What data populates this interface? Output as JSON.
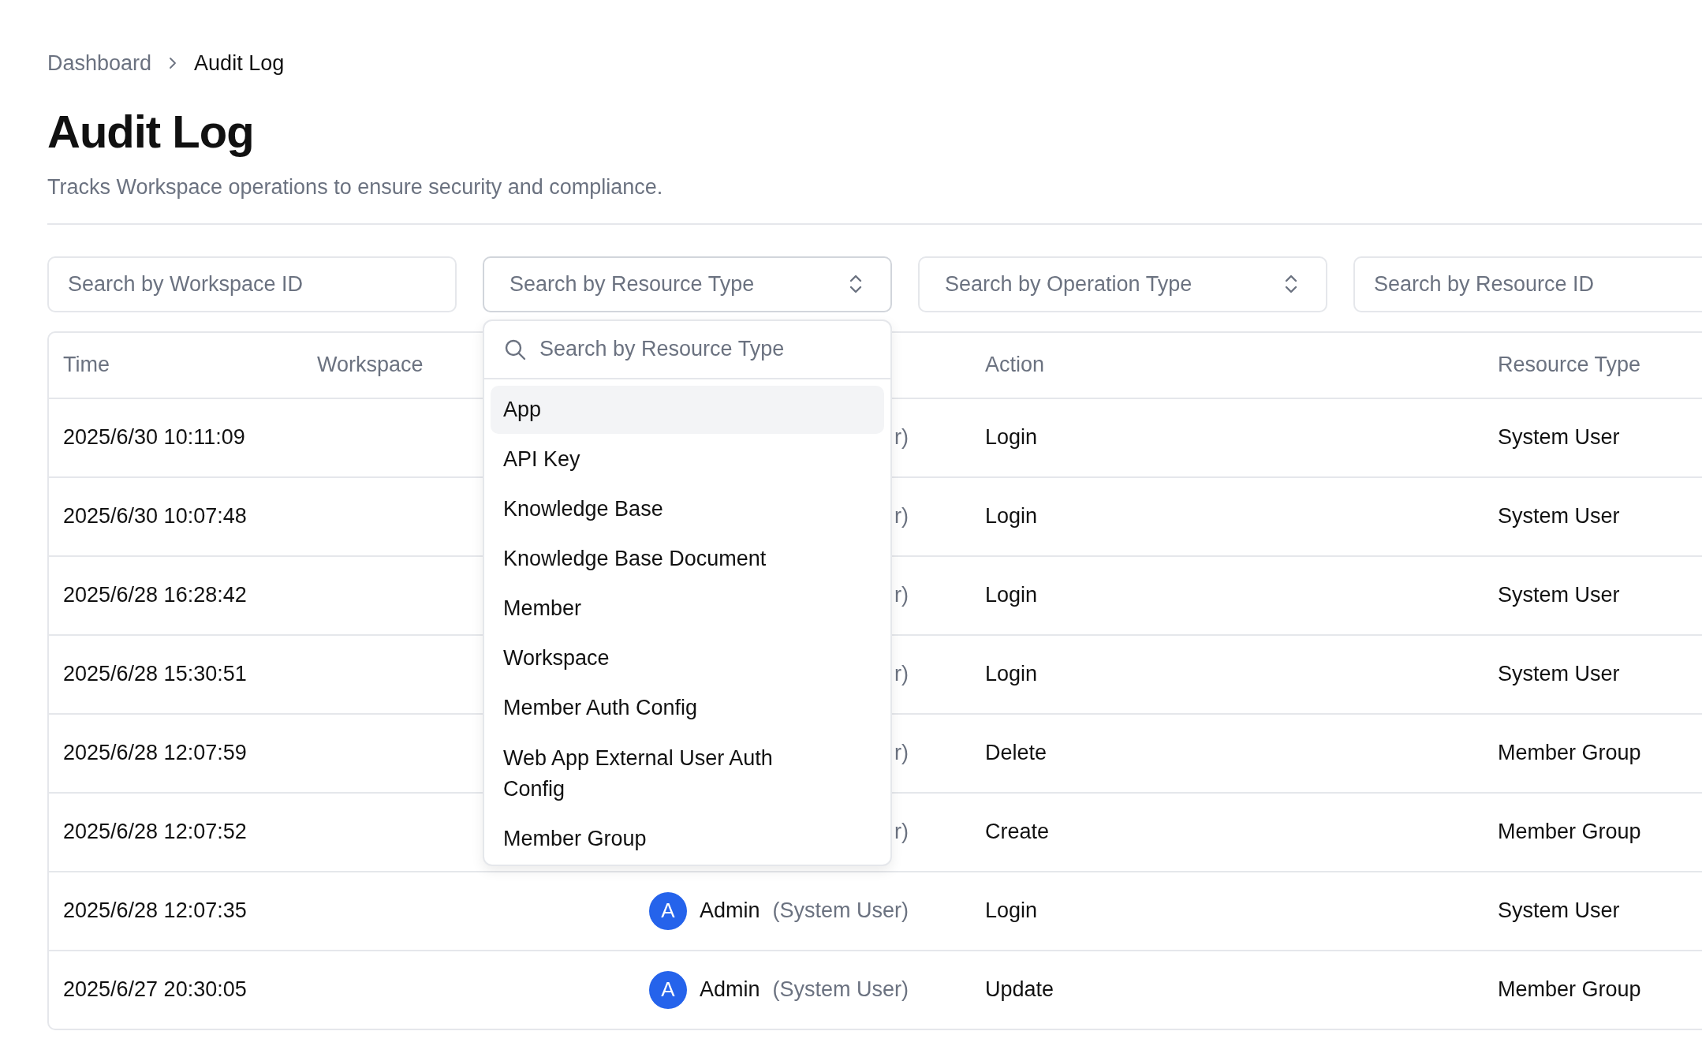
{
  "breadcrumb": [
    {
      "label": "Dashboard",
      "current": false
    },
    {
      "label": "Audit Log",
      "current": true
    }
  ],
  "title": "Audit Log",
  "subtitle": "Tracks Workspace operations to ensure security and compliance.",
  "filters": [
    {
      "kind": "text",
      "placeholder": "Search by Workspace ID"
    },
    {
      "kind": "select",
      "placeholder": "Search by Resource Type",
      "expanded": true
    },
    {
      "kind": "select",
      "placeholder": "Search by Operation Type",
      "expanded": false
    },
    {
      "kind": "text",
      "placeholder": "Search by Resource ID"
    }
  ],
  "dropdown": {
    "search_placeholder": "Search by Resource Type",
    "options": [
      {
        "label": "App",
        "selected": true
      },
      {
        "label": "API Key",
        "selected": false
      },
      {
        "label": "Knowledge Base",
        "selected": false
      },
      {
        "label": "Knowledge Base Document",
        "selected": false
      },
      {
        "label": "Member",
        "selected": false
      },
      {
        "label": "Workspace",
        "selected": false
      },
      {
        "label": "Member Auth Config",
        "selected": false
      },
      {
        "label": "Web App External User Auth Config",
        "selected": false
      },
      {
        "label": "Member Group",
        "selected": false
      }
    ]
  },
  "table": {
    "columns": [
      "Time",
      "Workspace",
      "",
      "Action",
      "Resource Type"
    ],
    "rows": [
      {
        "time": "2025/6/30 10:11:09",
        "operator": {
          "role": "r)"
        },
        "action": "Login",
        "resource_type": "System User"
      },
      {
        "time": "2025/6/30 10:07:48",
        "operator": {
          "role": "r)"
        },
        "action": "Login",
        "resource_type": "System User"
      },
      {
        "time": "2025/6/28 16:28:42",
        "operator": {
          "role": "r)"
        },
        "action": "Login",
        "resource_type": "System User"
      },
      {
        "time": "2025/6/28 15:30:51",
        "operator": {
          "role": "r)"
        },
        "action": "Login",
        "resource_type": "System User"
      },
      {
        "time": "2025/6/28 12:07:59",
        "operator": {
          "role": "r)"
        },
        "action": "Delete",
        "resource_type": "Member Group"
      },
      {
        "time": "2025/6/28 12:07:52",
        "operator": {
          "role": "r)"
        },
        "action": "Create",
        "resource_type": "Member Group"
      },
      {
        "time": "2025/6/28 12:07:35",
        "operator": {
          "avatar": "A",
          "name": "Admin",
          "role": "(System User)"
        },
        "action": "Login",
        "resource_type": "System User"
      },
      {
        "time": "2025/6/27 20:30:05",
        "operator": {
          "avatar": "A",
          "name": "Admin",
          "role": "(System User)"
        },
        "action": "Update",
        "resource_type": "Member Group"
      }
    ]
  }
}
